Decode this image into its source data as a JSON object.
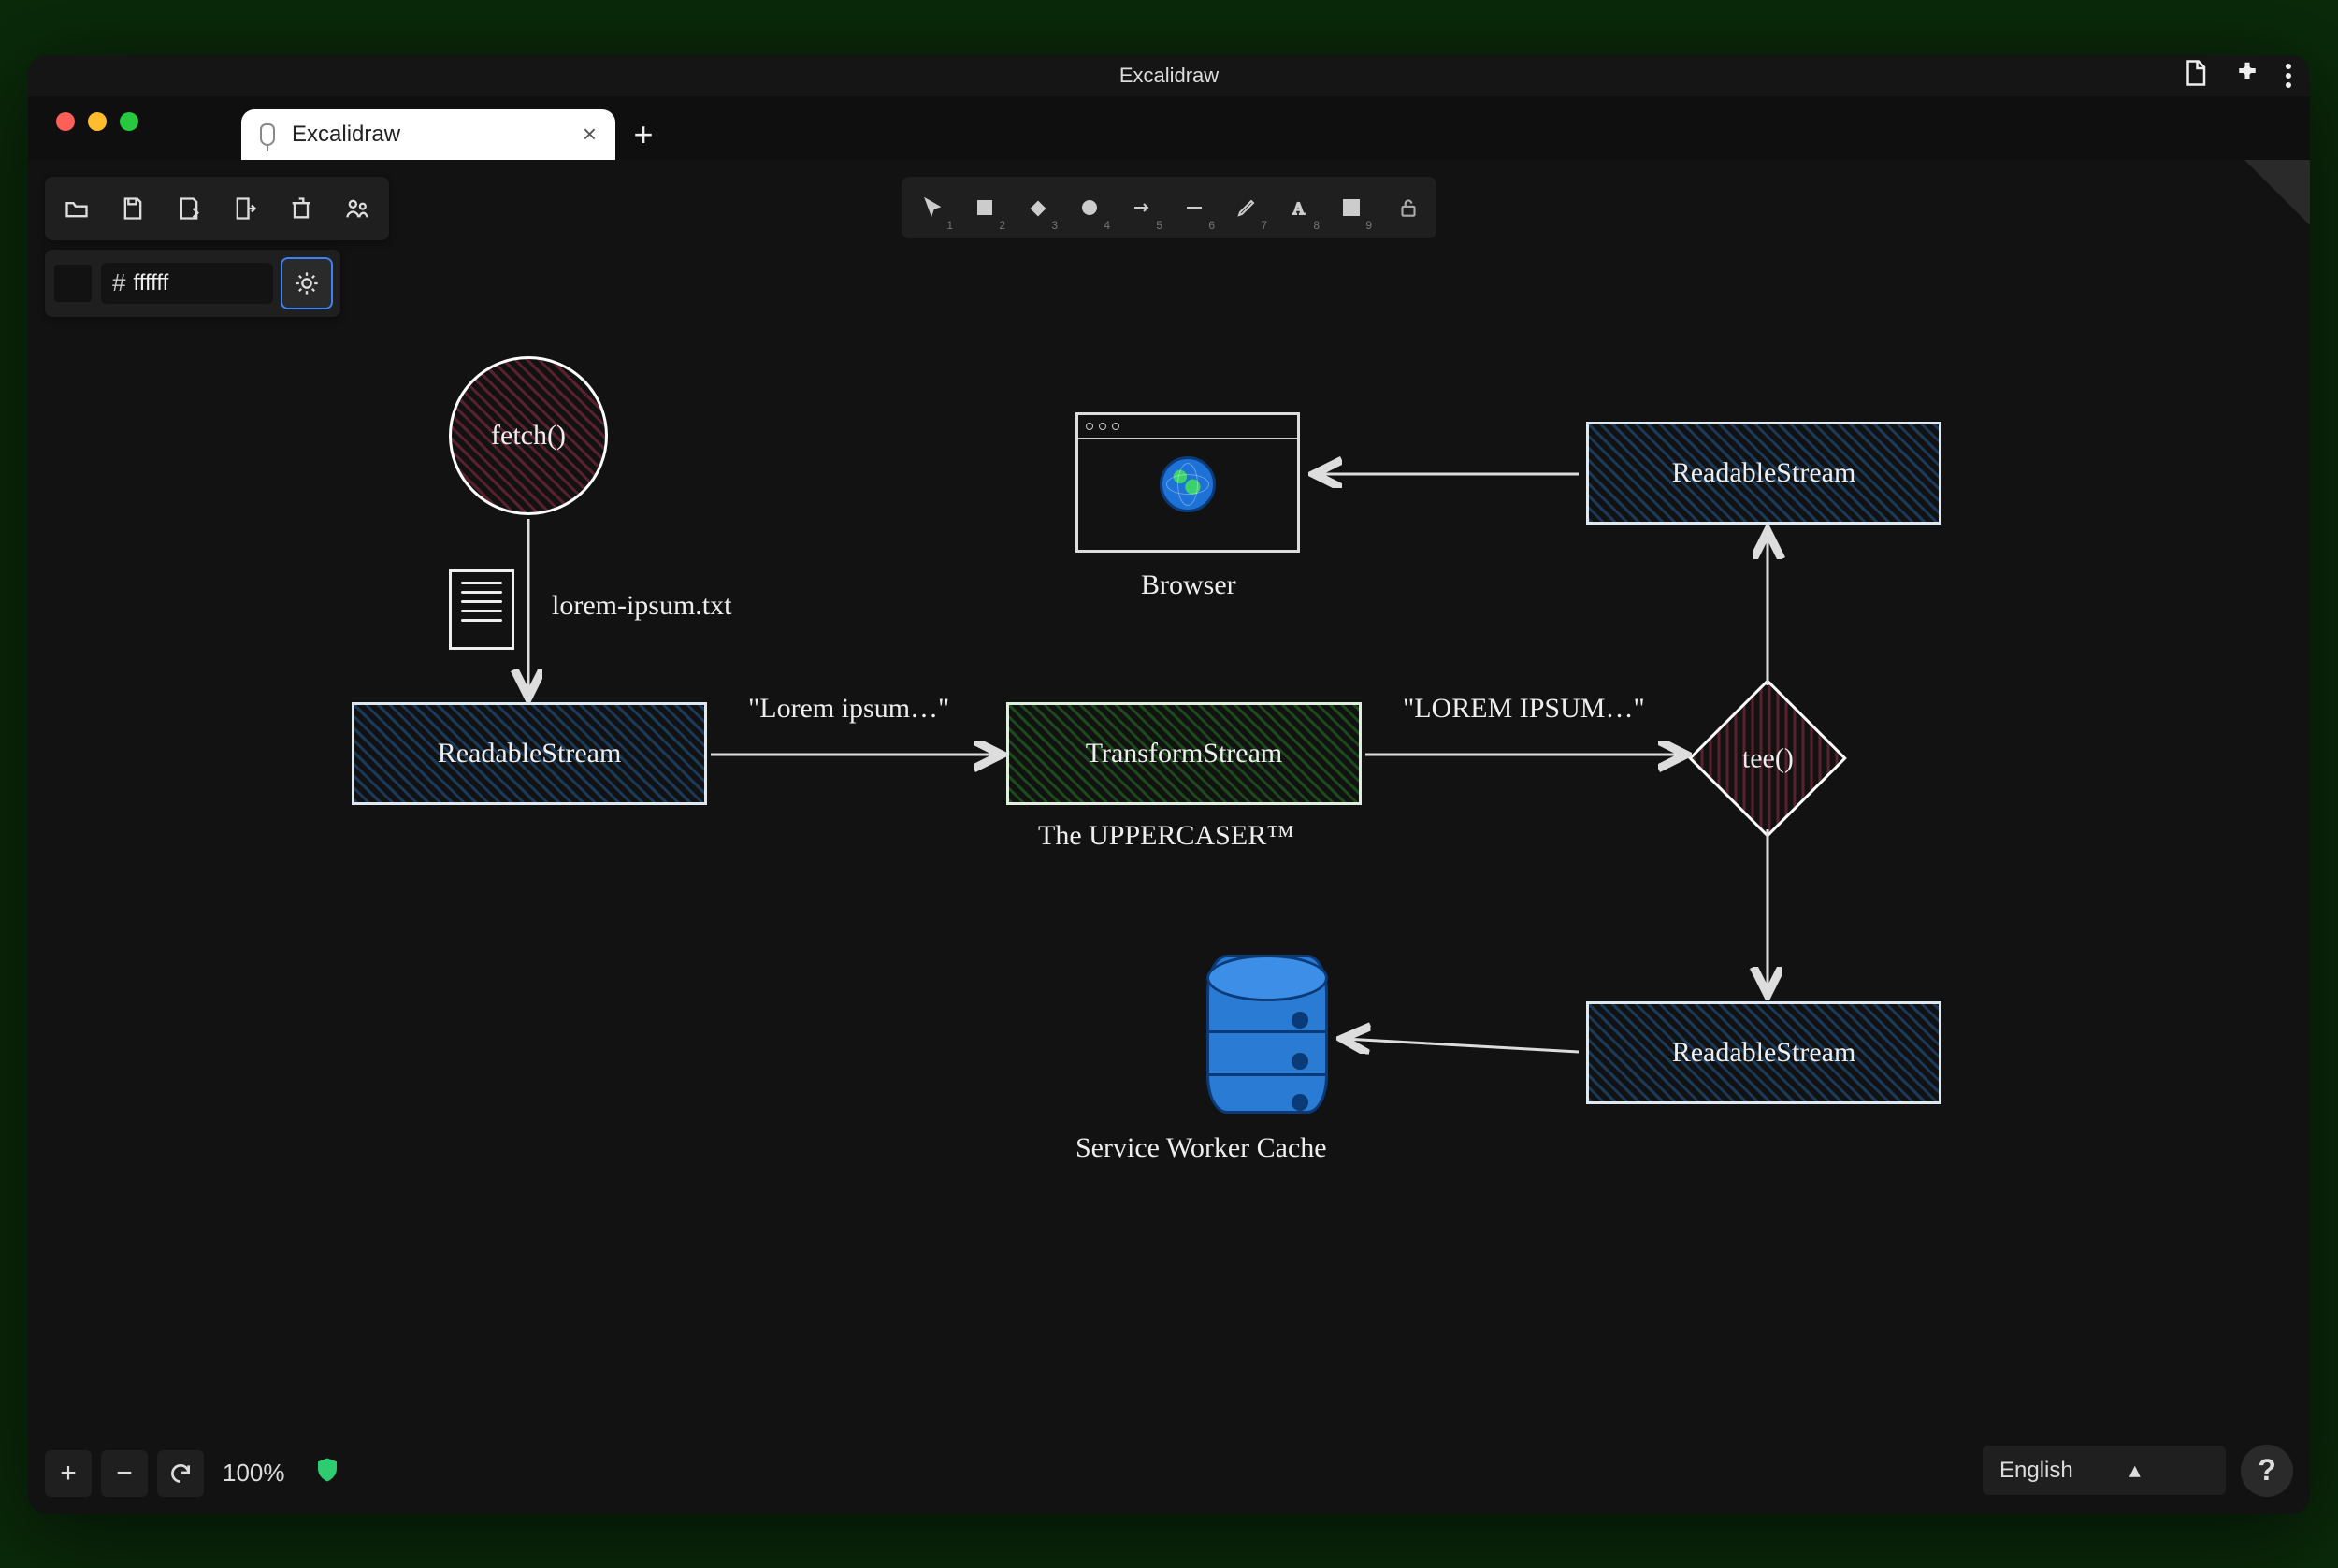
{
  "window": {
    "title": "Excalidraw"
  },
  "tab": {
    "title": "Excalidraw"
  },
  "color": {
    "hex": "ffffff"
  },
  "tools": {
    "select": "1",
    "rectangle": "2",
    "diamond": "3",
    "circle": "4",
    "arrow": "5",
    "line": "6",
    "pencil": "7",
    "text": "8",
    "image": "9"
  },
  "zoom": {
    "level": "100%"
  },
  "language": {
    "selected": "English"
  },
  "diagram": {
    "fetch": "fetch()",
    "filename": "lorem-ipsum.txt",
    "readable1": "ReadableStream",
    "lorem_lower": "\"Lorem ipsum…\"",
    "transform": "TransformStream",
    "uppercaser": "The UPPERCASER™",
    "lorem_upper": "\"LOREM IPSUM…\"",
    "tee": "tee()",
    "readable2": "ReadableStream",
    "readable3": "ReadableStream",
    "browser": "Browser",
    "cache": "Service Worker Cache"
  }
}
